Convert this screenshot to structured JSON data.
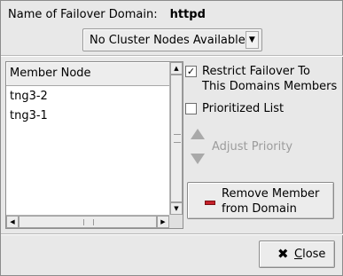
{
  "domain": {
    "label": "Name of Failover Domain:",
    "value": "httpd"
  },
  "node_selector": {
    "selected": "No Cluster Nodes Available",
    "arrow_icon": "chevron-down-icon"
  },
  "member_list": {
    "header": "Member Node",
    "rows": [
      "tng3-2",
      "tng3-1"
    ]
  },
  "options": {
    "restrict_label_line1": "Restrict Failover To",
    "restrict_label_line2": "This Domains Members",
    "restrict_checked": true,
    "restrict_mark": "✓",
    "prioritized_label": "Prioritized List",
    "prioritized_checked": false
  },
  "priority": {
    "label": "Adjust Priority",
    "up_icon": "arrow-up-icon",
    "down_icon": "arrow-down-icon"
  },
  "remove_button": {
    "line1": "Remove Member",
    "line2": "from Domain",
    "icon": "minus-icon",
    "icon_color": "#c6202a"
  },
  "close_button": {
    "mnemonic": "C",
    "rest": "lose",
    "icon": "close-icon",
    "icon_glyph": "✖"
  }
}
